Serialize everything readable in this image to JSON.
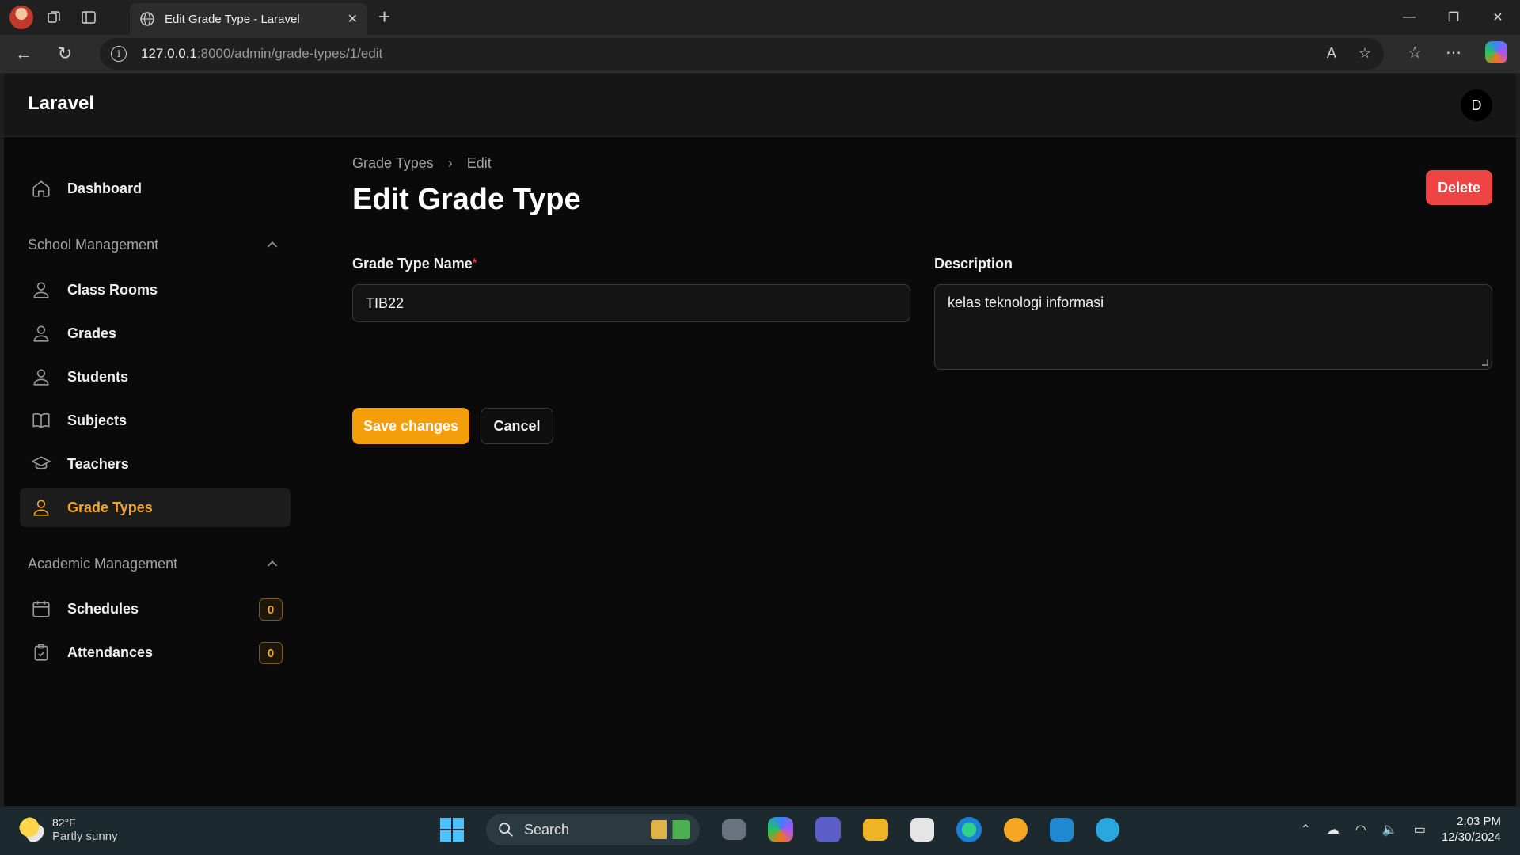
{
  "browser": {
    "tab_title": "Edit Grade Type - Laravel",
    "url_host": "127.0.0.1",
    "url_rest": ":8000/admin/grade-types/1/edit"
  },
  "app": {
    "brand": "Laravel",
    "user_initial": "D"
  },
  "sidebar": {
    "top_items": [
      {
        "label": "Dashboard",
        "icon": "home-icon"
      }
    ],
    "groups": [
      {
        "label": "School Management",
        "items": [
          {
            "label": "Class Rooms",
            "icon": "user-icon"
          },
          {
            "label": "Grades",
            "icon": "user-icon"
          },
          {
            "label": "Students",
            "icon": "user-icon"
          },
          {
            "label": "Subjects",
            "icon": "book-icon"
          },
          {
            "label": "Teachers",
            "icon": "graduation-cap-icon"
          },
          {
            "label": "Grade Types",
            "icon": "user-icon",
            "active": true
          }
        ]
      },
      {
        "label": "Academic Management",
        "items": [
          {
            "label": "Schedules",
            "icon": "calendar-icon",
            "badge": "0"
          },
          {
            "label": "Attendances",
            "icon": "clipboard-check-icon",
            "badge": "0"
          }
        ]
      }
    ]
  },
  "main": {
    "breadcrumb": [
      "Grade Types",
      "Edit"
    ],
    "title": "Edit Grade Type",
    "delete_label": "Delete",
    "form": {
      "name_label": "Grade Type Name",
      "name_required_mark": "*",
      "name_value": "TIB22",
      "description_label": "Description",
      "description_value": "kelas teknologi informasi"
    },
    "save_label": "Save changes",
    "cancel_label": "Cancel"
  },
  "taskbar": {
    "weather_temp": "82°F",
    "weather_cond": "Partly sunny",
    "search_label": "Search",
    "time": "2:03 PM",
    "date": "12/30/2024"
  },
  "colors": {
    "accent": "#f5a623",
    "danger": "#ef4444",
    "save": "#f59e0b"
  }
}
